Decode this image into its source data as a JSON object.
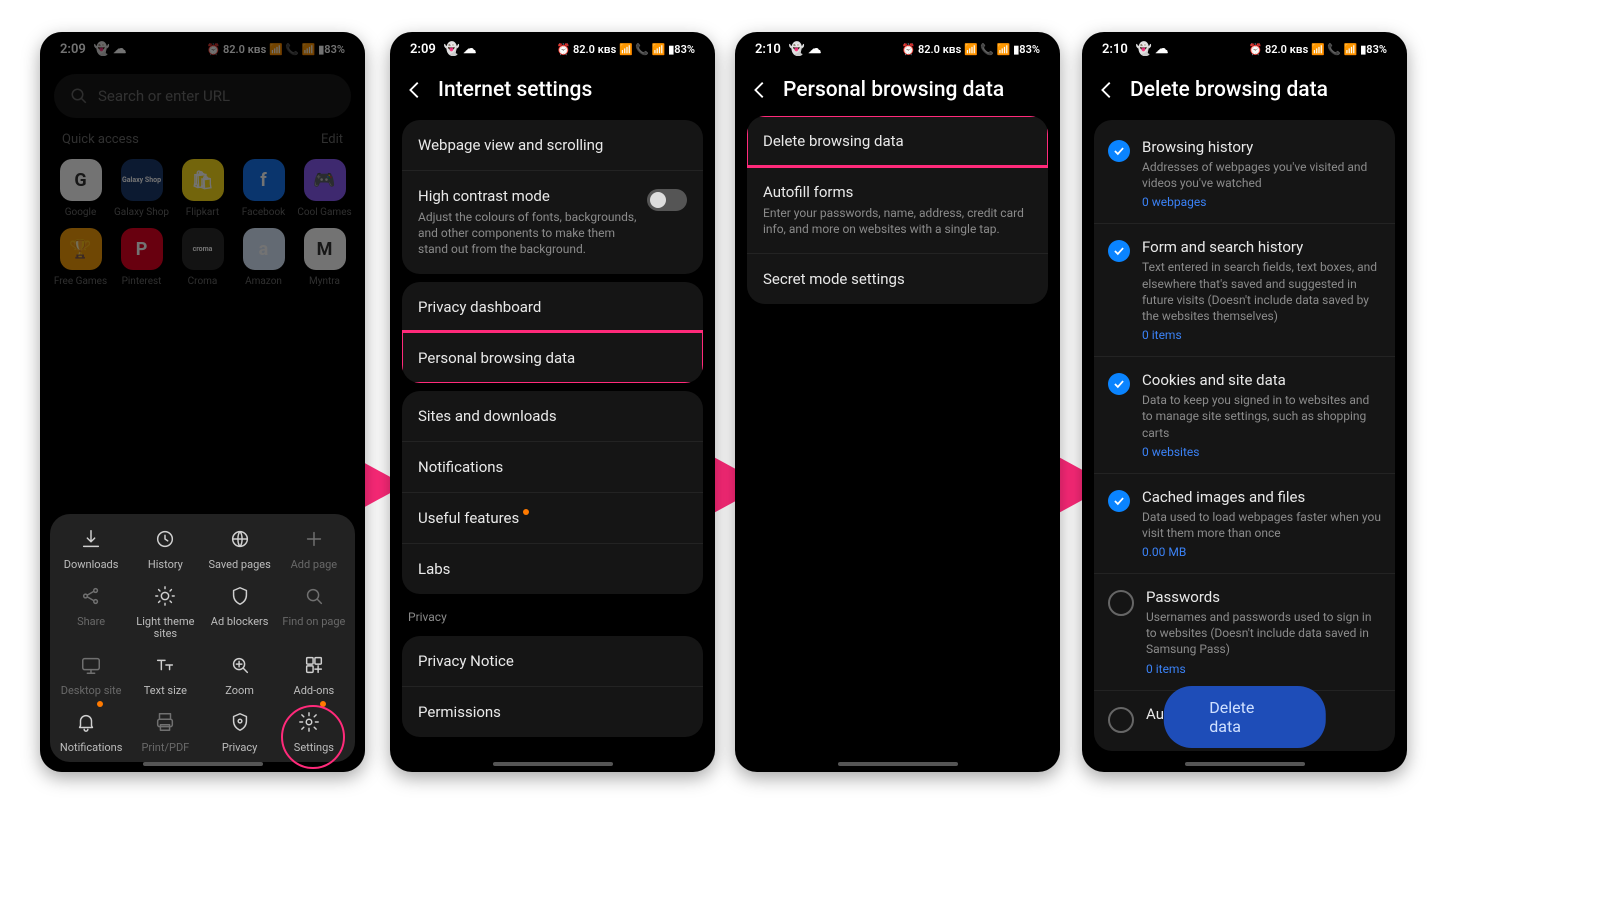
{
  "status": {
    "time1": "2:09",
    "time2": "2:09",
    "time3": "2:10",
    "time4": "2:10",
    "icons": "👻 ☁",
    "right": "⏰ 82.0 ᴋʙs 📶 📞 📶 ▮83%"
  },
  "p1": {
    "search_placeholder": "Search or enter URL",
    "quick": "Quick access",
    "edit": "Edit",
    "apps": [
      {
        "label": "Google",
        "bg": "#fff",
        "txt": "G"
      },
      {
        "label": "Galaxy Shop",
        "bg": "#1b3a6e",
        "txt": "Galaxy Shop"
      },
      {
        "label": "Flipkart",
        "bg": "#ffe11b",
        "txt": "🛍"
      },
      {
        "label": "Facebook",
        "bg": "#1877f2",
        "txt": "f"
      },
      {
        "label": "Cool Games",
        "bg": "#8b5cf6",
        "txt": "🎮"
      },
      {
        "label": "Free Games",
        "bg": "#f59e0b",
        "txt": "🏆"
      },
      {
        "label": "Pinterest",
        "bg": "#e60023",
        "txt": "P"
      },
      {
        "label": "Croma",
        "bg": "#2a2a2a",
        "txt": "croma"
      },
      {
        "label": "Amazon",
        "bg": "#dbeafe",
        "txt": "a"
      },
      {
        "label": "Myntra",
        "bg": "#fff",
        "txt": "M"
      }
    ],
    "sheet": [
      {
        "label": "Downloads",
        "icon": "download"
      },
      {
        "label": "History",
        "icon": "clock"
      },
      {
        "label": "Saved pages",
        "icon": "globe"
      },
      {
        "label": "Add page",
        "icon": "plus",
        "dim": true
      },
      {
        "label": "Share",
        "icon": "share",
        "dim": true
      },
      {
        "label": "Light theme sites",
        "icon": "sun"
      },
      {
        "label": "Ad blockers",
        "icon": "shield"
      },
      {
        "label": "Find on page",
        "icon": "find",
        "dim": true
      },
      {
        "label": "Desktop site",
        "icon": "desktop",
        "dim": true
      },
      {
        "label": "Text size",
        "icon": "text"
      },
      {
        "label": "Zoom",
        "icon": "zoom"
      },
      {
        "label": "Add-ons",
        "icon": "addons"
      },
      {
        "label": "Notifications",
        "icon": "bell",
        "badge": true
      },
      {
        "label": "Print/PDF",
        "icon": "print",
        "dim": true
      },
      {
        "label": "Privacy",
        "icon": "privacy"
      },
      {
        "label": "Settings",
        "icon": "gear",
        "badge": true,
        "circle": true
      }
    ]
  },
  "p2": {
    "title": "Internet settings",
    "g1": [
      {
        "t": "Webpage view and scrolling"
      },
      {
        "t": "High contrast mode",
        "s": "Adjust the colours of fonts, backgrounds, and other components to make them stand out from the background.",
        "toggle": true
      }
    ],
    "g2": [
      {
        "t": "Privacy dashboard"
      },
      {
        "t": "Personal browsing data",
        "hl": true
      }
    ],
    "g3": [
      {
        "t": "Sites and downloads"
      },
      {
        "t": "Notifications"
      },
      {
        "t": "Useful features",
        "badge": true
      },
      {
        "t": "Labs"
      }
    ],
    "privacy_label": "Privacy",
    "g4": [
      {
        "t": "Privacy Notice"
      },
      {
        "t": "Permissions"
      }
    ]
  },
  "p3": {
    "title": "Personal browsing data",
    "rows": [
      {
        "t": "Delete browsing data",
        "hl": true
      },
      {
        "t": "Autofill forms",
        "s": "Enter your passwords, name, address, credit card info, and more on websites with a single tap."
      },
      {
        "t": "Secret mode settings"
      }
    ]
  },
  "p4": {
    "title": "Delete browsing data",
    "items": [
      {
        "t": "Browsing history",
        "s": "Addresses of webpages you've visited and videos you've watched",
        "m": "0 webpages",
        "c": true
      },
      {
        "t": "Form and search history",
        "s": "Text entered in search fields, text boxes, and elsewhere that's saved and suggested in future visits (Doesn't include data saved by the websites themselves)",
        "m": "0 items",
        "c": true
      },
      {
        "t": "Cookies and site data",
        "s": "Data to keep you signed in to websites and to manage site settings, such as shopping carts",
        "m": "0 websites",
        "c": true
      },
      {
        "t": "Cached images and files",
        "s": "Data used to load webpages faster when you visit them more than once",
        "m": "0.00 MB",
        "c": true
      },
      {
        "t": "Passwords",
        "s": "Usernames and passwords used to sign in to websites (Doesn't include data saved in Samsung Pass)",
        "m": "0 items",
        "c": false
      },
      {
        "t": "Autofill forms",
        "s": "",
        "m": "",
        "c": false
      }
    ],
    "delete": "Delete data"
  }
}
